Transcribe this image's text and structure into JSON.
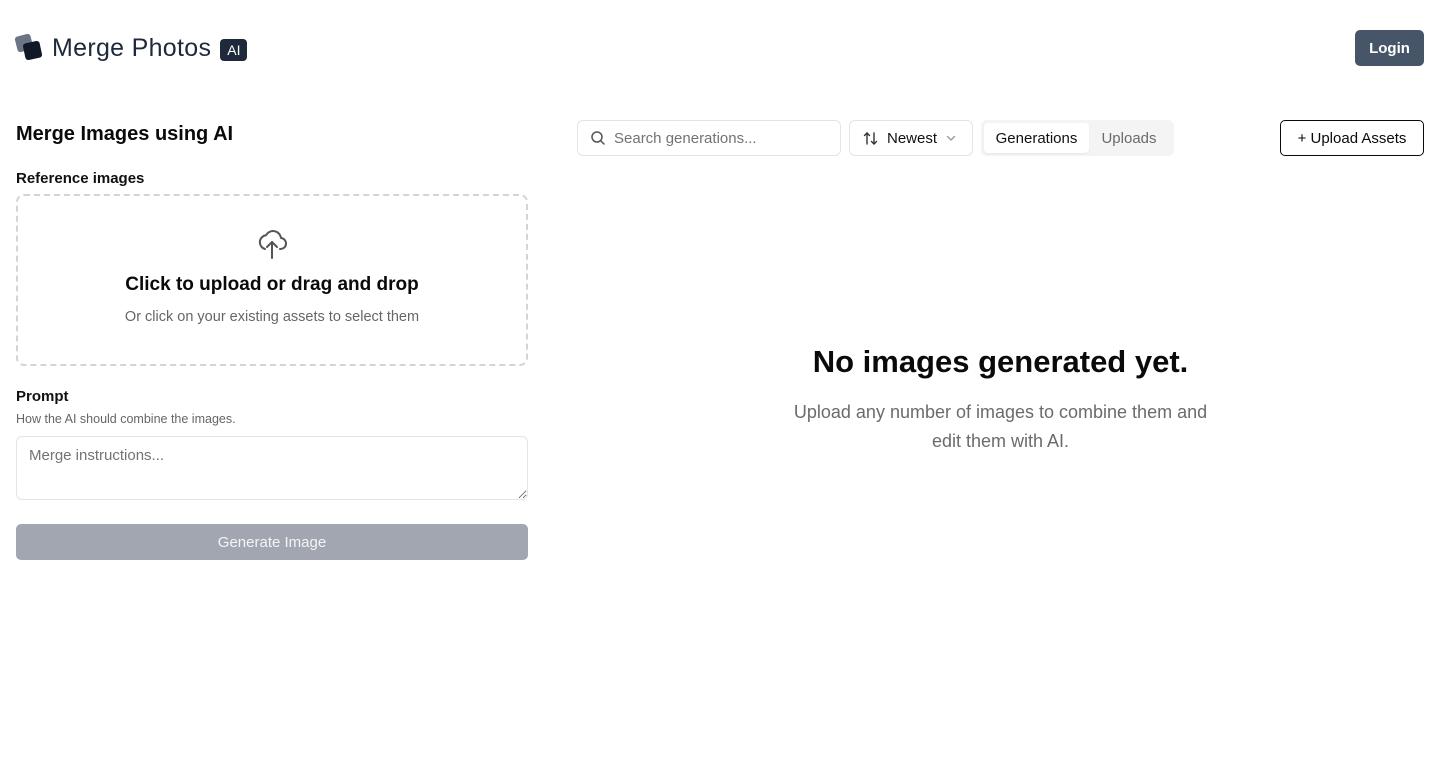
{
  "header": {
    "logo_text": "Merge Photos",
    "logo_badge": "AI",
    "login_label": "Login"
  },
  "form": {
    "title": "Merge Images using AI",
    "reference_label": "Reference images",
    "dropzone_title": "Click to upload or drag and drop",
    "dropzone_subtitle": "Or click on your existing assets to select them",
    "prompt_label": "Prompt",
    "prompt_help": "How the AI should combine the images.",
    "prompt_placeholder": "Merge instructions...",
    "prompt_value": "",
    "generate_label": "Generate Image"
  },
  "toolbar": {
    "search_placeholder": "Search generations...",
    "search_value": "",
    "sort_label": "Newest",
    "tabs": [
      {
        "label": "Generations",
        "active": true
      },
      {
        "label": "Uploads",
        "active": false
      }
    ],
    "upload_assets_label": "+ Upload Assets"
  },
  "empty_state": {
    "title": "No images generated yet.",
    "subtitle": "Upload any number of images to combine them and edit them with AI."
  },
  "colors": {
    "primary_dark": "#1e293b",
    "login_bg": "#475569",
    "disabled_button": "#a1a6b1",
    "border": "#e4e4e7"
  },
  "icons": {
    "logo": "stacked-squares-logo-icon",
    "upload": "cloud-upload-icon",
    "search": "search-icon",
    "sort": "sort-arrows-icon",
    "chevron": "chevron-down-icon"
  }
}
